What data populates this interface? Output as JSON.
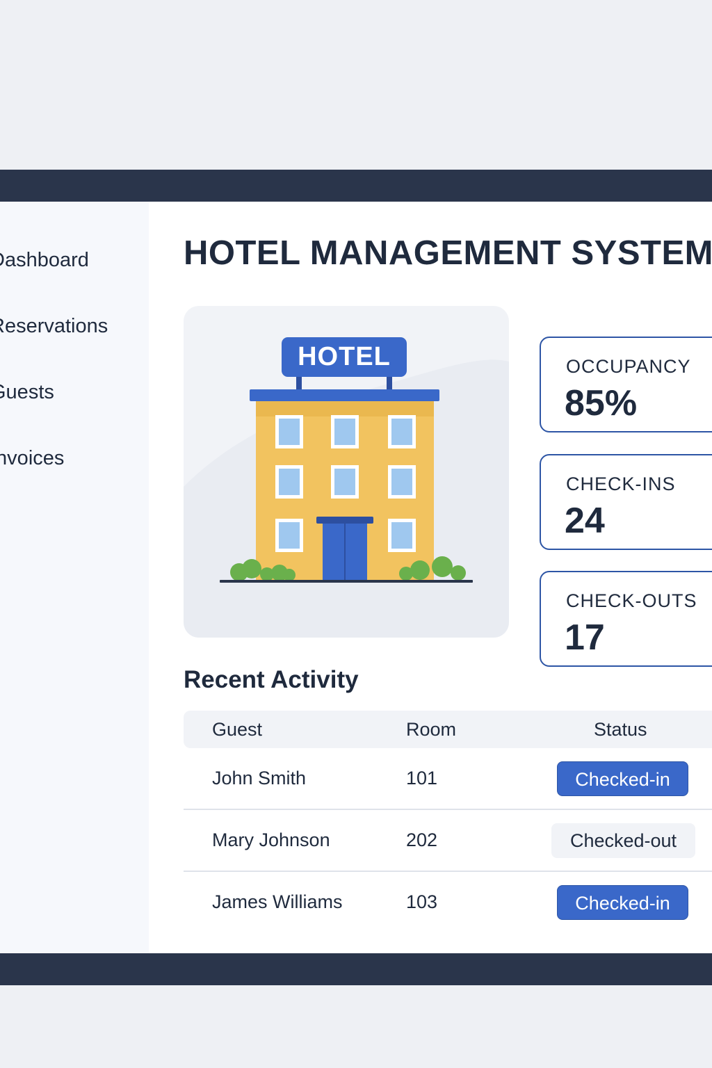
{
  "sidebar": {
    "items": [
      {
        "label": "Dashboard"
      },
      {
        "label": "Reservations"
      },
      {
        "label": "Guests"
      },
      {
        "label": "Invoices"
      }
    ]
  },
  "header": {
    "title": "HOTEL MANAGEMENT SYSTEM"
  },
  "hero": {
    "sign_text": "HOTEL",
    "icon": "hotel-building-illustration"
  },
  "stats": [
    {
      "label": "OCCUPANCY",
      "value": "85%"
    },
    {
      "label": "CHECK-INS",
      "value": "24"
    },
    {
      "label": "CHECK-OUTS",
      "value": "17"
    }
  ],
  "activity": {
    "title": "Recent Activity",
    "columns": [
      "Guest",
      "Room",
      "Status"
    ],
    "rows": [
      {
        "guest": "John Smith",
        "room": "101",
        "status": "Checked-in"
      },
      {
        "guest": "Mary Johnson",
        "room": "202",
        "status": "Checked-out"
      },
      {
        "guest": "James Williams",
        "room": "103",
        "status": "Checked-in"
      }
    ]
  },
  "colors": {
    "bar": "#2a354b",
    "accent": "#3a68c9",
    "card_border": "#2d55a5",
    "building": "#f2c35f",
    "text": "#1f2a3d"
  }
}
